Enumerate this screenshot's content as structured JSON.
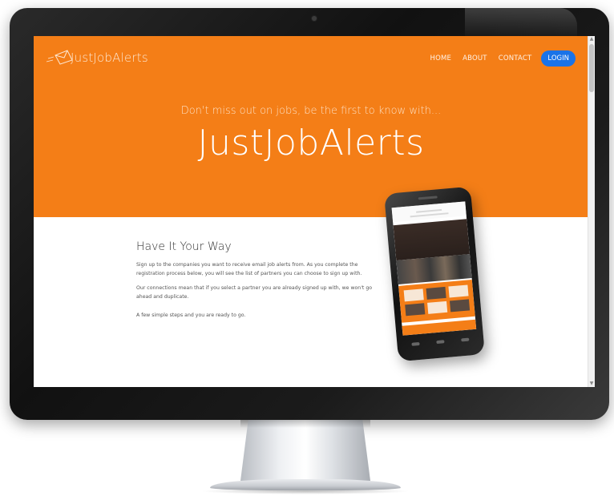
{
  "site": {
    "logo_text": "JustJobAlerts",
    "logo_icon": "envelope-icon"
  },
  "nav": {
    "items": [
      {
        "label": "HOME"
      },
      {
        "label": "ABOUT"
      },
      {
        "label": "CONTACT"
      }
    ],
    "login_label": "LOGIN"
  },
  "hero": {
    "tagline": "Don't miss out on jobs, be the first to know with...",
    "title": "JustJobAlerts"
  },
  "section": {
    "title": "Have It Your Way",
    "paragraphs": [
      "Sign up to the companies you want to receive email job alerts from. As you complete the registration process below, you will see the list of partners you can choose to sign up with.",
      "Our connections mean that if you select a partner you are already signed up with, we won't go ahead and duplicate.",
      "A few simple steps and you are ready to go."
    ]
  },
  "colors": {
    "brand_orange": "#f47e17",
    "login_blue": "#1a73e8",
    "bezel": "#1b1b1b"
  }
}
